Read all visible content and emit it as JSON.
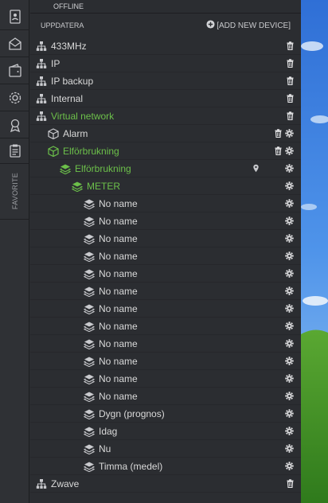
{
  "status": {
    "offline_label": "OFFLINE"
  },
  "header": {
    "title": "UPPDATERA",
    "add_device_label": "[ADD NEW DEVICE]"
  },
  "sidebar": {
    "favorite_label": "FAVORITE"
  },
  "colors": {
    "green": "#6cc04a",
    "background": "#2b2d31",
    "text": "#d9d9d9"
  },
  "tree": [
    {
      "label": "433MHz",
      "icon": "network-icon",
      "color": "default",
      "delete": true,
      "settings": false
    },
    {
      "label": "IP",
      "icon": "network-icon",
      "color": "default",
      "delete": true,
      "settings": false
    },
    {
      "label": "IP backup",
      "icon": "network-icon",
      "color": "default",
      "delete": true,
      "settings": false
    },
    {
      "label": "Internal",
      "icon": "network-icon",
      "color": "default",
      "delete": true,
      "settings": false
    },
    {
      "label": "Virtual network",
      "icon": "network-icon",
      "color": "green",
      "delete": true,
      "settings": false
    },
    {
      "label": "Alarm",
      "icon": "cube-icon",
      "color": "default",
      "delete": true,
      "settings": true
    },
    {
      "label": "Elförbrukning",
      "icon": "cube-icon",
      "color": "green",
      "delete": true,
      "settings": true
    },
    {
      "label": "Elförbrukning",
      "icon": "layers-icon",
      "color": "green",
      "delete": false,
      "settings": true,
      "location": true
    },
    {
      "label": "METER",
      "icon": "layers-icon",
      "color": "green",
      "delete": false,
      "settings": true
    },
    {
      "label": "No name",
      "icon": "layers-icon",
      "color": "default",
      "delete": false,
      "settings": true
    },
    {
      "label": "No name",
      "icon": "layers-icon",
      "color": "default",
      "delete": false,
      "settings": true
    },
    {
      "label": "No name",
      "icon": "layers-icon",
      "color": "default",
      "delete": false,
      "settings": true
    },
    {
      "label": "No name",
      "icon": "layers-icon",
      "color": "default",
      "delete": false,
      "settings": true
    },
    {
      "label": "No name",
      "icon": "layers-icon",
      "color": "default",
      "delete": false,
      "settings": true
    },
    {
      "label": "No name",
      "icon": "layers-icon",
      "color": "default",
      "delete": false,
      "settings": true
    },
    {
      "label": "No name",
      "icon": "layers-icon",
      "color": "default",
      "delete": false,
      "settings": true
    },
    {
      "label": "No name",
      "icon": "layers-icon",
      "color": "default",
      "delete": false,
      "settings": true
    },
    {
      "label": "No name",
      "icon": "layers-icon",
      "color": "default",
      "delete": false,
      "settings": true
    },
    {
      "label": "No name",
      "icon": "layers-icon",
      "color": "default",
      "delete": false,
      "settings": true
    },
    {
      "label": "No name",
      "icon": "layers-icon",
      "color": "default",
      "delete": false,
      "settings": true
    },
    {
      "label": "No name",
      "icon": "layers-icon",
      "color": "default",
      "delete": false,
      "settings": true
    },
    {
      "label": "Dygn (prognos)",
      "icon": "layers-icon",
      "color": "default",
      "delete": false,
      "settings": true
    },
    {
      "label": "Idag",
      "icon": "layers-icon",
      "color": "default",
      "delete": false,
      "settings": true
    },
    {
      "label": "Nu",
      "icon": "layers-icon",
      "color": "default",
      "delete": false,
      "settings": true
    },
    {
      "label": "Timma (medel)",
      "icon": "layers-icon",
      "color": "default",
      "delete": false,
      "settings": true
    },
    {
      "label": "Zwave",
      "icon": "network-icon",
      "color": "default",
      "delete": true,
      "settings": false
    }
  ]
}
